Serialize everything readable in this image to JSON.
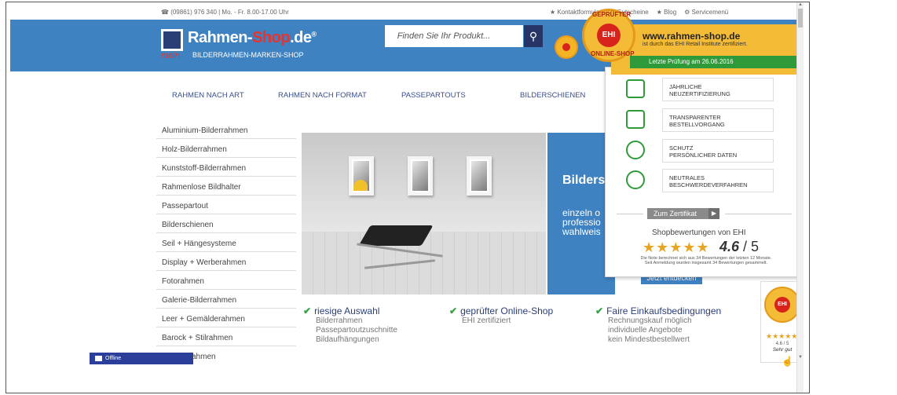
{
  "topbar": {
    "phone": "☎ (09861) 976 340 | Mo. - Fr. 8.00-17.00 Uhr",
    "links": [
      "★ Kontaktformular",
      "★ Gutscheine",
      "★ Blog",
      "⚙ Servicemenü"
    ]
  },
  "logo": {
    "name_a": "Rahmen-",
    "name_b": "Shop",
    "name_c": ".de",
    "reg": "®",
    "mein": "mein",
    "tagline": "BILDERRAHMEN-MARKEN-SHOP"
  },
  "search": {
    "placeholder": "Finden Sie Ihr Produkt...",
    "icon": "search-icon"
  },
  "nav": [
    "RAHMEN NACH ART",
    "RAHMEN NACH FORMAT",
    "PASSEPARTOUTS",
    "BILDERSCHIENEN"
  ],
  "sidebar": [
    "Aluminium-Bilderrahmen",
    "Holz-Bilderrahmen",
    "Kunststoff-Bilderrahmen",
    "Rahmenlose Bildhalter",
    "Passepartout",
    "Bilderschienen",
    "Seil + Hängesysteme",
    "Display + Werberahmen",
    "Fotorahmen",
    "Galerie-Bilderrahmen",
    "Leer + Gemälderahmen",
    "Barock + Stilrahmen"
  ],
  "sidebar_peek": "ahmen",
  "hero": {
    "title": "Bilders",
    "text_1": "einzeln o",
    "text_2": "professio",
    "text_3": "wahlweis",
    "button": "Jetzt entdecken"
  },
  "features": [
    {
      "title": "riesige Auswahl",
      "lines": [
        "Bilderrahmen",
        "Passepartoutzuschnitte",
        "Bildaufhängungen"
      ]
    },
    {
      "title": "geprüfter Online-Shop",
      "lines": [
        "EHI zertifiziert"
      ]
    },
    {
      "title": "Faire Einkaufsbedingungen",
      "lines": [
        "Rechnungskauf möglich",
        "individuelle Angebote",
        "kein Mindestbestellwert"
      ]
    }
  ],
  "ehi": {
    "seal_top": "GEPRÜFTER",
    "seal_mid": "EHI",
    "seal_bottom": "ONLINE-SHOP",
    "url": "www.rahmen-shop.de",
    "cert": "ist durch das EHI Retail Institute zertifiziert.",
    "last_check": "Letzte Prüfung am 26.06.2016",
    "items": [
      {
        "line1": "JÄHRLICHE",
        "line2": "NEUZERTIFIZIERUNG",
        "icon": "calendar-check-icon"
      },
      {
        "line1": "TRANSPARENTER",
        "line2": "BESTELLVORGANG",
        "icon": "shopping-bag-check-icon"
      },
      {
        "line1": "SCHUTZ",
        "line2": "PERSÖNLICHER DATEN",
        "icon": "document-icon"
      },
      {
        "line1": "NEUTRALES",
        "line2": "BESCHWERDEVERFAHREN",
        "icon": "chat-bubble-icon"
      }
    ],
    "cert_button": "Zum Zertifikat",
    "rating_title": "Shopbewertungen von EHI",
    "stars": "★★★★★",
    "score": "4.6",
    "score_max": " / 5",
    "note_1": "Die Note berechnet sich aus 34 Bewertungen der letzten 12 Monate.",
    "note_2": "Seit Anmeldung wurden insgesamt 34 Bewertungen gesammelt."
  },
  "ehi_side": {
    "seal": "EHI",
    "stars": "★★★★★",
    "score": "4.6 / 5",
    "label": "Sehr gut"
  },
  "chat": {
    "status": "Offline"
  },
  "colors": {
    "brand_blue": "#3f82c2",
    "dark_blue": "#263466",
    "ehi_yellow": "#f4bc36",
    "ehi_red": "#d8231c",
    "check_green": "#36a043"
  }
}
